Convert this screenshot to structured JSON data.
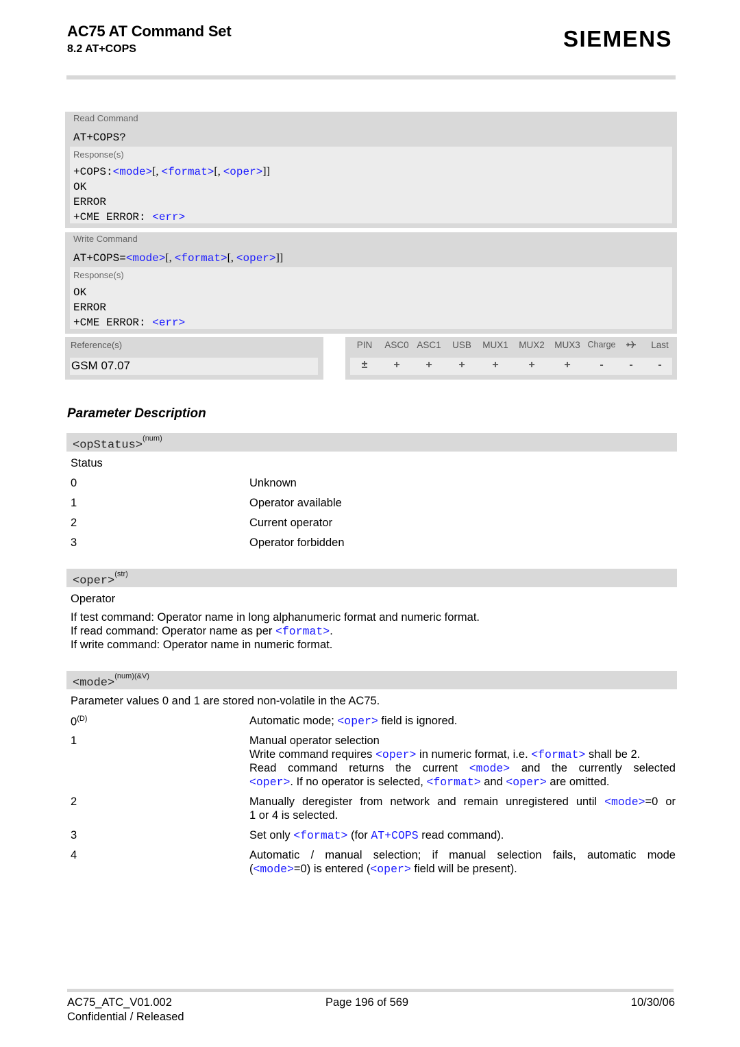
{
  "header": {
    "title": "AC75 AT Command Set",
    "section": "8.2 AT+COPS",
    "logo": "SIEMENS"
  },
  "read_command": {
    "label": "Read Command",
    "command": "AT+COPS?",
    "responses_label": "Response(s)",
    "response_prefix": "+COPS:",
    "response_mode": "<mode>",
    "response_sep1": "[, ",
    "response_format": "<format>",
    "response_sep2": "[, ",
    "response_oper": "<oper>",
    "response_close": "]]",
    "ok": "OK",
    "error": "ERROR",
    "cme_prefix": "+CME ERROR: ",
    "cme_err": "<err>"
  },
  "write_command": {
    "label": "Write Command",
    "command_prefix": "AT+COPS=",
    "mode": "<mode>",
    "sep1": "[, ",
    "format": "<format>",
    "sep2": "[, ",
    "oper": "<oper>",
    "close": "]]",
    "responses_label": "Response(s)",
    "ok": "OK",
    "error": "ERROR",
    "cme_prefix": "+CME ERROR: ",
    "cme_err": "<err>"
  },
  "reference": {
    "label": "Reference(s)",
    "value": "GSM 07.07"
  },
  "flags": {
    "headers": [
      "PIN",
      "ASC0",
      "ASC1",
      "USB",
      "MUX1",
      "MUX2",
      "MUX3",
      "Charge",
      "airplane-icon",
      "Last"
    ],
    "values": [
      "±",
      "+",
      "+",
      "+",
      "+",
      "+",
      "+",
      "-",
      "-",
      "-"
    ]
  },
  "parameters": {
    "heading": "Parameter Description",
    "opstatus": {
      "name": "<opStatus>",
      "type": "(num)",
      "title": "Status",
      "values": [
        {
          "value": "0",
          "desc": "Unknown"
        },
        {
          "value": "1",
          "desc": "Operator available"
        },
        {
          "value": "2",
          "desc": "Current operator"
        },
        {
          "value": "3",
          "desc": "Operator forbidden"
        }
      ]
    },
    "oper": {
      "name": "<oper>",
      "type": "(str)",
      "title": "Operator",
      "line1": "If test command: Operator name in long alphanumeric format and numeric format.",
      "line2_prefix": "If read command: Operator name as per ",
      "line2_link": "<format>",
      "line2_suffix": ".",
      "line3": "If write command: Operator name in numeric format."
    },
    "mode": {
      "name": "<mode>",
      "type": "(num)(&V)",
      "intro": "Parameter values 0 and 1 are stored non-volatile in the AC75.",
      "v0": "0",
      "v0_sup": "(D)",
      "v0_desc_a": "Automatic mode; ",
      "v0_desc_link": "<oper>",
      "v0_desc_b": " field is ignored.",
      "v1": "1",
      "v1_l1": "Manual operator selection",
      "v1_l2_a": "Write command requires ",
      "v1_l2_oper": "<oper>",
      "v1_l2_b": " in numeric format, i.e. ",
      "v1_l2_format": "<format>",
      "v1_l2_c": " shall be 2.",
      "v1_l3_a": "Read command returns the current ",
      "v1_l3_mode": "<mode>",
      "v1_l3_b": " and the currently selected",
      "v1_l4_oper": "<oper>",
      "v1_l4_a": ". If no operator is selected, ",
      "v1_l4_format": "<format>",
      "v1_l4_b": " and ",
      "v1_l4_oper2": "<oper>",
      "v1_l4_c": " are omitted.",
      "v2": "2",
      "v2_l1_a": "Manually deregister from network and remain unregistered until ",
      "v2_l1_mode": "<mode>",
      "v2_l1_b": "=0 or",
      "v2_l2": "1 or 4 is selected.",
      "v3": "3",
      "v3_a": "Set only ",
      "v3_format": "<format>",
      "v3_b": " (for ",
      "v3_cmd": "AT+COPS",
      "v3_c": " read command).",
      "v4": "4",
      "v4_l1": "Automatic / manual selection; if manual selection fails, automatic mode",
      "v4_l2_a": "(",
      "v4_l2_mode": "<mode>",
      "v4_l2_b": "=0) is entered (",
      "v4_l2_oper": "<oper>",
      "v4_l2_c": " field will be present)."
    }
  },
  "footer": {
    "doc_id": "AC75_ATC_V01.002",
    "page": "Page 196 of 569",
    "date": "10/30/06",
    "status": "Confidential / Released"
  },
  "colors": {
    "link": "#1a1aff",
    "box_bg": "#d9d9d9",
    "inner_bg": "#ececec"
  }
}
